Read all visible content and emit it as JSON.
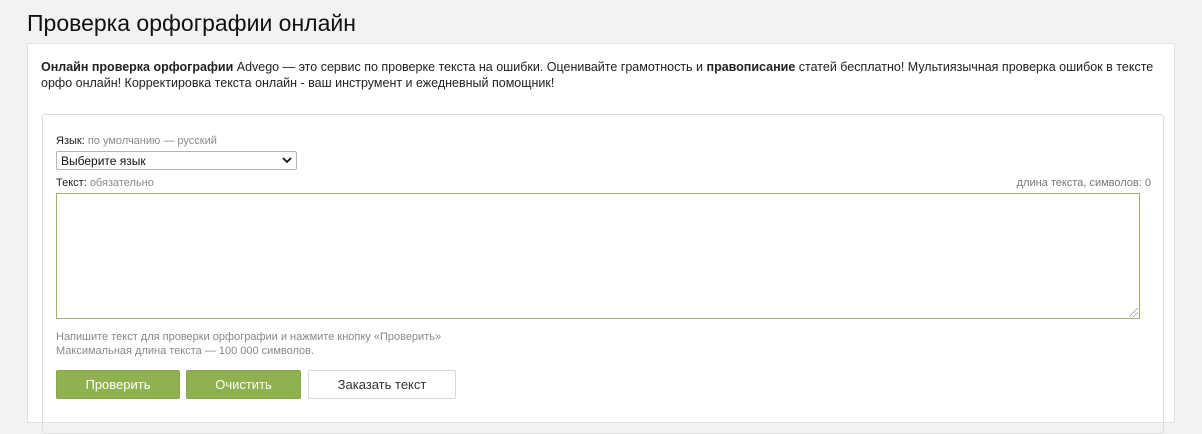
{
  "page": {
    "title": "Проверка орфографии онлайн"
  },
  "intro": {
    "bold1": "Онлайн проверка орфографии",
    "text1": " Advego — это сервис по проверке текста на ошибки. Оценивайте грамотность и ",
    "bold2": "правописание",
    "text2": " статей бесплатно! Мультиязычная проверка ошибок в тексте орфо онлайн! Корректировка текста онлайн - ваш инструмент и ежедневный помощник!"
  },
  "form": {
    "language_label": "Язык:",
    "language_hint": "по умолчанию — русский",
    "language_selected": "Выберите язык",
    "text_label": "Текст:",
    "text_hint": "обязательно",
    "length_label": "длина текста, символов: 0",
    "textarea_value": "",
    "help_line1": "Напишите текст для проверки орфографии и нажмите кнопку «Проверить»",
    "help_line2": "Максимальная длина текста — 100 000 символов."
  },
  "buttons": {
    "check": "Проверить",
    "clear": "Очистить",
    "order": "Заказать текст"
  },
  "colors": {
    "accent": "#8fb14f",
    "textarea_border": "#9bb66a"
  }
}
